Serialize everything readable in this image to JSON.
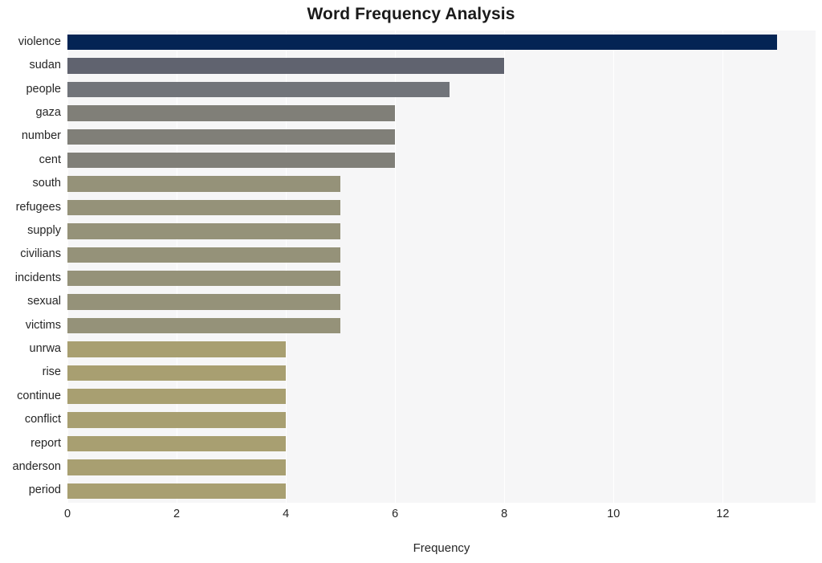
{
  "chart": {
    "title": "Word Frequency Analysis",
    "xlabel": "Frequency",
    "ylabel": ""
  },
  "chart_data": {
    "type": "bar",
    "orientation": "horizontal",
    "title": "Word Frequency Analysis",
    "xlabel": "Frequency",
    "ylabel": "",
    "categories": [
      "violence",
      "sudan",
      "people",
      "gaza",
      "number",
      "cent",
      "south",
      "refugees",
      "supply",
      "civilians",
      "incidents",
      "sexual",
      "victims",
      "unrwa",
      "rise",
      "continue",
      "conflict",
      "report",
      "anderson",
      "period"
    ],
    "values": [
      13,
      8,
      7,
      6,
      6,
      6,
      5,
      5,
      5,
      5,
      5,
      5,
      5,
      4,
      4,
      4,
      4,
      4,
      4,
      4
    ],
    "bar_colors": [
      "#042454",
      "#60636f",
      "#71747a",
      "#807f78",
      "#807f78",
      "#807f78",
      "#959279",
      "#959279",
      "#959279",
      "#959279",
      "#959279",
      "#959279",
      "#959279",
      "#a89f71",
      "#a89f71",
      "#a89f71",
      "#a89f71",
      "#a89f71",
      "#a89f71",
      "#a89f71"
    ],
    "xlim": [
      0,
      13.7
    ],
    "xticks": [
      0,
      2,
      4,
      6,
      8,
      10,
      12
    ],
    "xtick_labels": [
      "0",
      "2",
      "4",
      "6",
      "8",
      "10",
      "12"
    ],
    "grid": true,
    "grid_axis": "x",
    "legend": false,
    "plot_background": "#f6f6f7",
    "figure_background": "#ffffff"
  }
}
